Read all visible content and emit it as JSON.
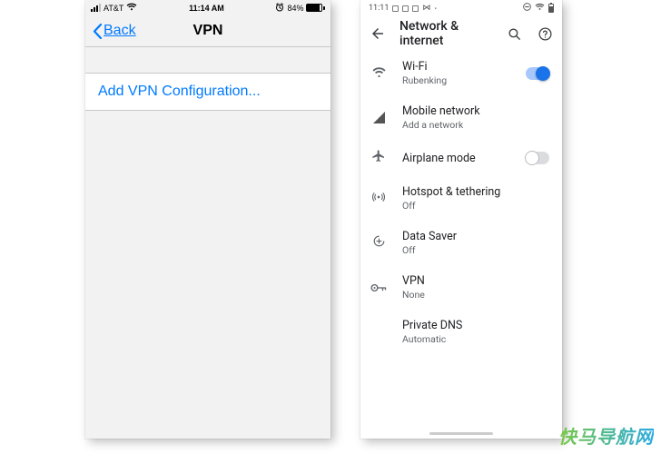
{
  "ios": {
    "status": {
      "carrier": "AT&T",
      "time": "11:14 AM",
      "battery_pct": "84%"
    },
    "nav": {
      "back_label": "Back",
      "title": "VPN"
    },
    "add_row": "Add VPN Configuration..."
  },
  "android": {
    "status": {
      "time": "11:11"
    },
    "appbar": {
      "title": "Network & internet"
    },
    "items": [
      {
        "icon": "wifi",
        "title": "Wi-Fi",
        "subtitle": "Rubenking",
        "toggle": "on"
      },
      {
        "icon": "signal",
        "title": "Mobile network",
        "subtitle": "Add a network"
      },
      {
        "icon": "airplane",
        "title": "Airplane mode",
        "subtitle": "",
        "toggle": "off"
      },
      {
        "icon": "hotspot",
        "title": "Hotspot & tethering",
        "subtitle": "Off"
      },
      {
        "icon": "saver",
        "title": "Data Saver",
        "subtitle": "Off"
      },
      {
        "icon": "vpn",
        "title": "VPN",
        "subtitle": "None"
      },
      {
        "icon": "",
        "title": "Private DNS",
        "subtitle": "Automatic"
      }
    ]
  },
  "watermark": "快马导航网"
}
